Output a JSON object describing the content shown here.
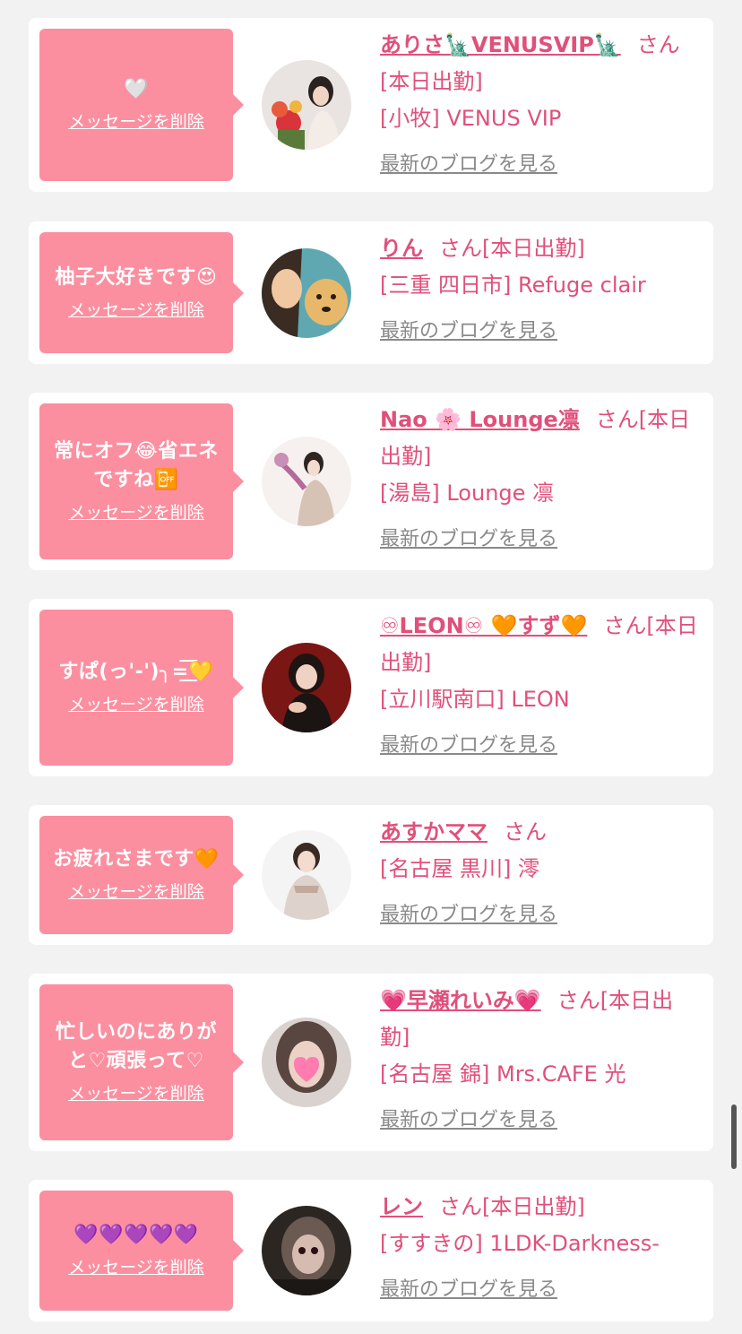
{
  "delete_label": "メッセージを削除",
  "blog_label": "最新のブログを見る",
  "accent_color": "#fb8fa0",
  "name_color": "#e0507a",
  "items": [
    {
      "message": "🤍",
      "name": "ありさ🗽VENUSVIP🗽",
      "suffix": "さん[本日出勤]",
      "shop": "[小牧] VENUS VIP",
      "avatar": "woman-with-flowers"
    },
    {
      "message": "柚子大好きです😍",
      "name": "りん",
      "suffix": "さん[本日出勤]",
      "shop": "[三重 四日市] Refuge clair",
      "avatar": "woman-with-dog"
    },
    {
      "message": "常にオフ😂省エネ\nですね📴",
      "name": "Nao 🌸 Lounge凛",
      "suffix": "さん[本日出勤]",
      "shop": "[湯島] Lounge 凛",
      "avatar": "woman-kimono-fan"
    },
    {
      "message": "すぱ(っ'-')╮=͟͟͞͞💛",
      "name": "♾LEON♾ 🧡すず🧡",
      "suffix": "さん[本日出勤]",
      "shop": "[立川駅南口] LEON",
      "avatar": "woman-red-background"
    },
    {
      "message": "お疲れさまです🧡",
      "name": "あすかママ",
      "suffix": "さん",
      "shop": "[名古屋 黒川] 澪",
      "avatar": "woman-kimono"
    },
    {
      "message": "忙しいのにありが\nと♡頑張って♡",
      "name": "💗早瀬れいみ💗",
      "suffix": "さん[本日出勤]",
      "shop": "[名古屋 錦] Mrs.CAFE 光",
      "avatar": "woman-heart-sticker"
    },
    {
      "message": "💜💜💜💜💜",
      "name": "レン",
      "suffix": "さん[本日出勤]",
      "shop": "[すすきの] 1LDK-Darkness-",
      "avatar": "woman-dark-makeup"
    }
  ]
}
